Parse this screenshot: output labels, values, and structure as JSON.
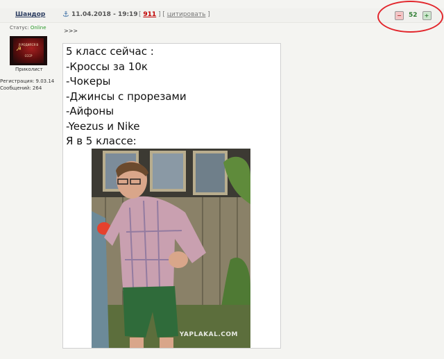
{
  "post_header": {
    "username": "Шандор",
    "anchor_icon": "anchor-icon",
    "datetime": "11.04.2018 - 19:19",
    "post_number": "911",
    "quote_label": "цитировать"
  },
  "rating": {
    "value": "52",
    "down_icon": "minus-icon",
    "up_icon": "plus-icon",
    "highlight_color": "#e2262c"
  },
  "user": {
    "status_label": "Статус:",
    "status_value": "Online",
    "avatar_text_top": "Я РОДИЛСЯ В",
    "avatar_text_bottom": "СССР",
    "title": "Приколист",
    "registration": "Регистрация: 9.03.14",
    "messages": "Сообщений: 264"
  },
  "post": {
    "quote_marker": ">>>",
    "lines": [
      "5 класс сейчас :",
      "-Кроссы за 10к",
      "-Чокеры",
      "-Джинсы с прорезами",
      "-Айфоны",
      "-Yeezus и Nike",
      "Я в 5 классе:"
    ],
    "image_watermark": "YAPLAKAL.COM"
  }
}
